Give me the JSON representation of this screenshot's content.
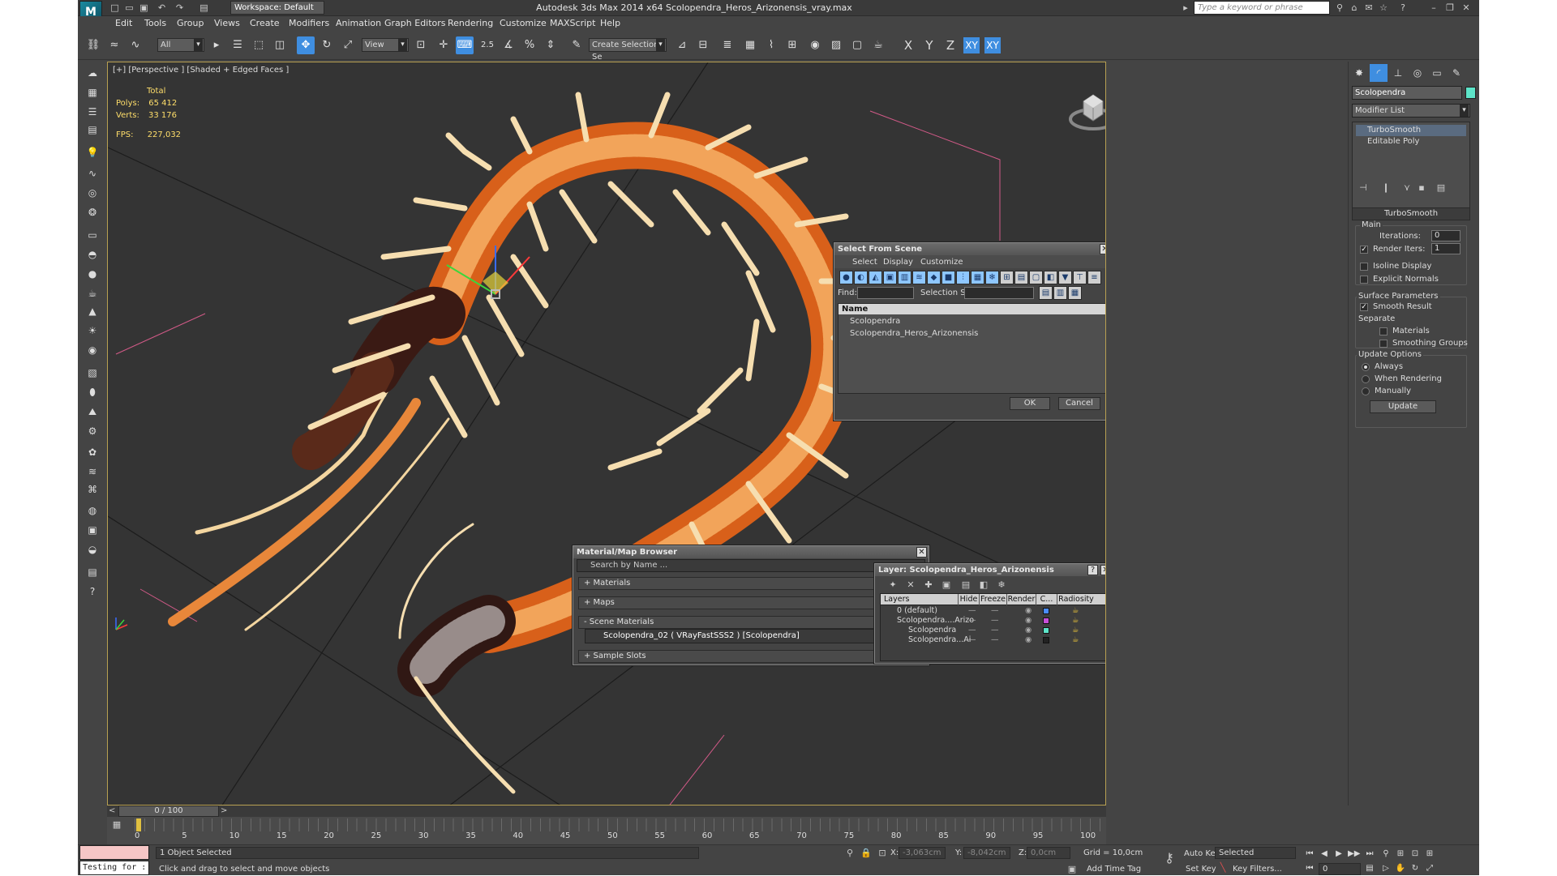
{
  "window": {
    "title": "Autodesk 3ds Max  2014 x64     Scolopendra_Heros_Arizonensis_vray.max",
    "workspace": "Workspace: Default",
    "search_placeholder": "Type a keyword or phrase"
  },
  "menu": [
    "Edit",
    "Tools",
    "Group",
    "Views",
    "Create",
    "Modifiers",
    "Animation",
    "Graph Editors",
    "Rendering",
    "Customize",
    "MAXScript",
    "Help"
  ],
  "toolbar": {
    "filter_value": "All",
    "refcoord_value": "View",
    "selection_set_placeholder": "Create Selection Se",
    "snap_angle": "2.5",
    "axis_x": "X",
    "axis_y": "Y",
    "axis_z": "Z",
    "axis_xy": "XY",
    "axis_xy2": "XY"
  },
  "viewport": {
    "label": "[+] [Perspective ] [Shaded + Edged Faces ]",
    "stats_header": "Total",
    "polys_label": "Polys:",
    "polys_value": "65 412",
    "verts_label": "Verts:",
    "verts_value": "33 176",
    "fps_label": "FPS:",
    "fps_value": "227,032"
  },
  "select_from_scene": {
    "title": "Select From Scene",
    "menu": [
      "Select",
      "Display",
      "Customize"
    ],
    "find_label": "Find:",
    "selection_set_label": "Selection Set:",
    "column_name": "Name",
    "items": [
      "Scolopendra",
      "Scolopendra_Heros_Arizonensis"
    ],
    "ok": "OK",
    "cancel": "Cancel"
  },
  "material_browser": {
    "title": "Material/Map Browser",
    "search_placeholder": "Search by Name ...",
    "rows": [
      "+ Materials",
      "+ Maps",
      "- Scene Materials"
    ],
    "material": "Scolopendra_02  ( VRayFastSSS2 )  [Scolopendra]",
    "sample_slots": "+ Sample Slots"
  },
  "layer_dialog": {
    "title": "Layer: Scolopendra_Heros_Arizonensis",
    "columns": [
      "Layers",
      "Hide",
      "Freeze",
      "Render",
      "C...",
      "Radiosity"
    ],
    "rows": [
      {
        "name": "0 (default)",
        "color": "#4a8cff"
      },
      {
        "name": "Scolopendra....Arizo",
        "color": "#c84fd8"
      },
      {
        "name": "Scolopendra",
        "color": "#5de4c8"
      },
      {
        "name": "Scolopendra...Ai",
        "color": "#222222"
      }
    ]
  },
  "command_panel": {
    "object_name": "Scolopendra",
    "object_color": "#5de4c8",
    "modifier_list": "Modifier List",
    "stack": [
      "TurboSmooth",
      "Editable Poly"
    ],
    "rollout_title": "TurboSmooth",
    "main_group": "Main",
    "iterations_label": "Iterations:",
    "iterations_value": "0",
    "render_iters_label": "Render Iters:",
    "render_iters_value": "1",
    "isoline": "Isoline Display",
    "explicit_normals": "Explicit Normals",
    "surface_group": "Surface Parameters",
    "smooth_result": "Smooth Result",
    "separate_label": "Separate",
    "materials": "Materials",
    "smoothing_groups": "Smoothing Groups",
    "update_group": "Update Options",
    "always": "Always",
    "when_rendering": "When Rendering",
    "manually": "Manually",
    "update_btn": "Update"
  },
  "timeline": {
    "frame": "0 / 100",
    "ticks": [
      "0",
      "5",
      "10",
      "15",
      "20",
      "25",
      "30",
      "35",
      "40",
      "45",
      "50",
      "55",
      "60",
      "65",
      "70",
      "75",
      "80",
      "85",
      "90",
      "95",
      "100"
    ]
  },
  "status": {
    "maxscript": "Testing for :",
    "selection": "1 Object Selected",
    "prompt": "Click and drag to select and move objects",
    "x_label": "X:",
    "x_value": "-3,063cm",
    "y_label": "Y:",
    "y_value": "-8,042cm",
    "z_label": "Z:",
    "z_value": "0,0cm",
    "grid": "Grid = 10,0cm",
    "add_time_tag": "Add Time Tag",
    "auto_key": "Auto Key",
    "selected": "Selected",
    "set_key": "Set Key",
    "key_filters": "Key Filters...",
    "frame_field": "0"
  }
}
